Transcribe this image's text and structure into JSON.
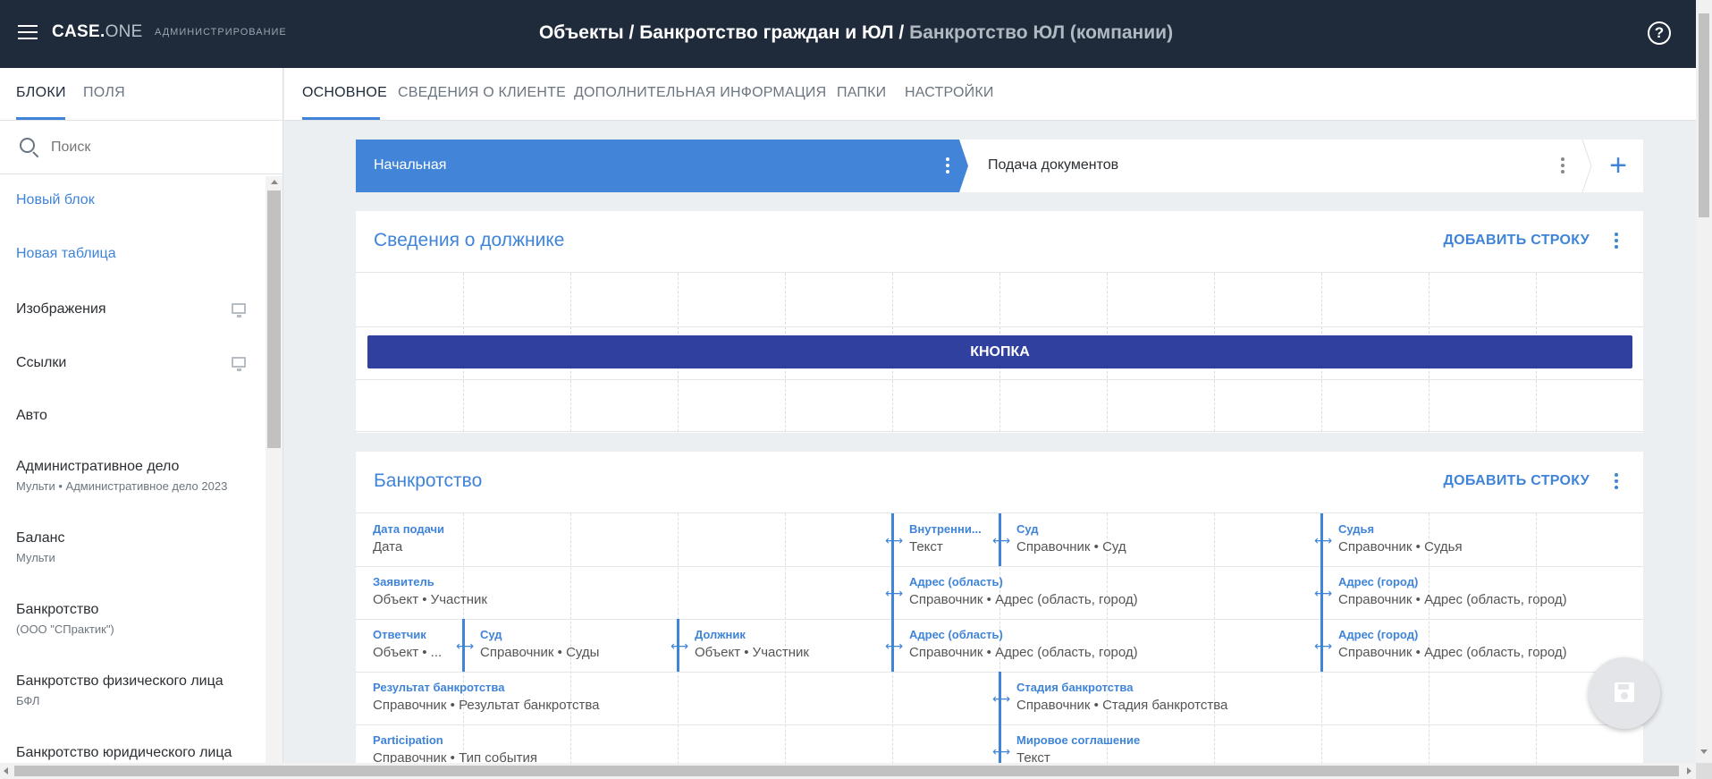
{
  "header": {
    "logo_main": "CASE.",
    "logo_accent": "ONE",
    "section_label": "АДМИНИСТРИРОВАНИЕ",
    "breadcrumb_1": "Объекты",
    "breadcrumb_sep": " / ",
    "breadcrumb_2": "Банкротство граждан и ЮЛ",
    "breadcrumb_3": "Банкротство ЮЛ (компании)",
    "help_glyph": "?"
  },
  "sidebar": {
    "tabs": [
      "БЛОКИ",
      "ПОЛЯ"
    ],
    "search_placeholder": "Поиск",
    "items": [
      {
        "title": "Новый блок",
        "subtitle": ""
      },
      {
        "title": "Новая таблица",
        "subtitle": ""
      },
      {
        "title": "Изображения",
        "subtitle": "",
        "icon": "monitor-icon"
      },
      {
        "title": "Ссылки",
        "subtitle": "",
        "icon": "monitor-icon"
      },
      {
        "title": "Авто",
        "subtitle": ""
      },
      {
        "title": "Административное дело",
        "subtitle": "Мульти • Административное дело 2023"
      },
      {
        "title": "Баланс",
        "subtitle": "Мульти"
      },
      {
        "title": "Банкротство",
        "subtitle": "(ООО \"СПрактик\")"
      },
      {
        "title": "Банкротство физического лица",
        "subtitle": "БФЛ"
      },
      {
        "title": "Банкротство юридического лица",
        "subtitle": ""
      }
    ]
  },
  "main_tabs": [
    "ОСНОВНОЕ",
    "СВЕДЕНИЯ О КЛИЕНТЕ",
    "ДОПОЛНИТЕЛЬНАЯ ИНФОРМАЦИЯ",
    "ПАПКИ",
    "НАСТРОЙКИ"
  ],
  "stages": {
    "active": "Начальная",
    "next": "Подача документов",
    "add_glyph": "+"
  },
  "debtor_card": {
    "title": "Сведения о должнике",
    "add_row": "ДОБАВИТЬ СТРОКУ",
    "button_label": "КНОПКА"
  },
  "bankruptcy_card": {
    "title": "Банкротство",
    "add_row": "ДОБАВИТЬ СТРОКУ",
    "fields": [
      {
        "label": "Дата подачи",
        "value": "Дата"
      },
      {
        "label": "Внутренни...",
        "value": "Текст"
      },
      {
        "label": "Суд",
        "value": "Справочник • Суд"
      },
      {
        "label": "Судья",
        "value": "Справочник • Судья"
      },
      {
        "label": "Заявитель",
        "value": "Объект • Участник"
      },
      {
        "label": "Адрес (область)",
        "value": "Справочник • Адрес (область, город)"
      },
      {
        "label": "Адрес (город)",
        "value": "Справочник • Адрес (область, город)"
      },
      {
        "label": "Ответчик",
        "value": "Объект • ..."
      },
      {
        "label": "Суд",
        "value": "Справочник • Суды"
      },
      {
        "label": "Должник",
        "value": "Объект • Участник"
      },
      {
        "label": "Адрес (область)",
        "value": "Справочник • Адрес (область, город)"
      },
      {
        "label": "Адрес (город)",
        "value": "Справочник • Адрес (область, город)"
      },
      {
        "label": "Результат банкротства",
        "value": "Справочник • Результат банкротства"
      },
      {
        "label": "Стадия банкротства",
        "value": "Справочник • Стадия банкротства"
      },
      {
        "label": "Participation",
        "value": "Справочник • Тип события"
      },
      {
        "label": "Мировое соглашение",
        "value": "Текст"
      }
    ]
  },
  "colors": {
    "topbar": "#1f2b3a",
    "accent": "#3f84d8",
    "stage_active": "#4285d8",
    "button": "#30409e"
  }
}
